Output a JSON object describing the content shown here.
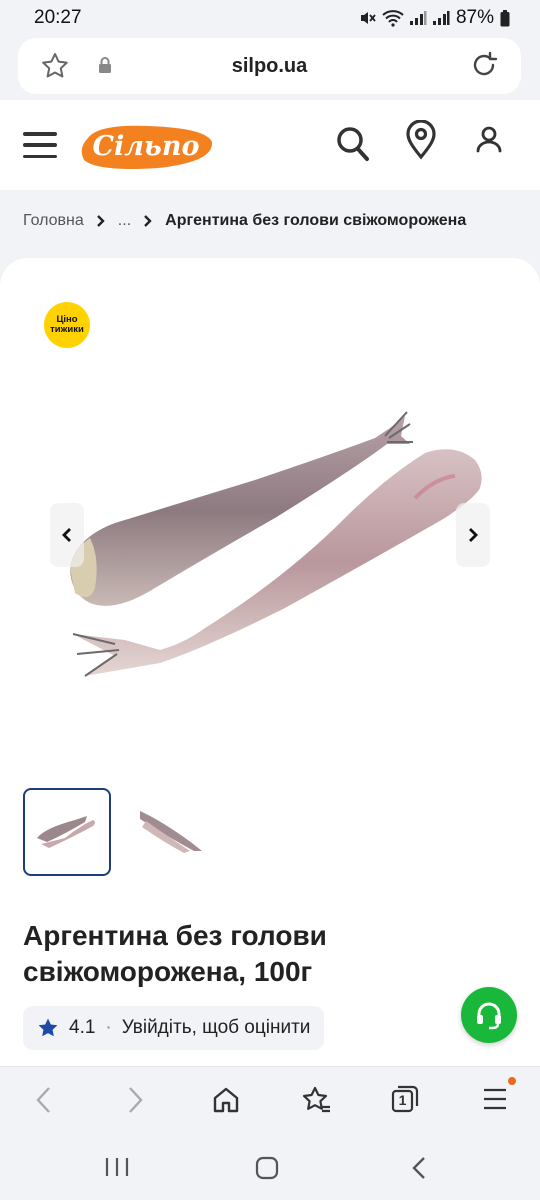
{
  "status_bar": {
    "time": "20:27",
    "battery": "87%"
  },
  "url_bar": {
    "domain": "silpo.ua"
  },
  "header": {
    "logo_text": "Сільпо",
    "brand_color": "#f48120"
  },
  "breadcrumb": {
    "home": "Головна",
    "ellipsis": "...",
    "current": "Аргентина без голови свіжоморожена"
  },
  "product": {
    "badge_line1": "Ціно",
    "badge_line2": "тижики",
    "title": "Аргентина без голови свіжоморожена, 100г",
    "rating": "4.1",
    "rating_sep": "·",
    "rating_prompt": "Увійдіть, щоб оцінити",
    "thumbnail_count": 2
  },
  "browser_nav": {
    "tabs_count": "1"
  },
  "colors": {
    "badge_yellow": "#ffd200",
    "support_green": "#19b83a",
    "active_border": "#1f3d7a",
    "rating_star": "#1f4ba8",
    "notification_dot": "#ea6a1e"
  }
}
